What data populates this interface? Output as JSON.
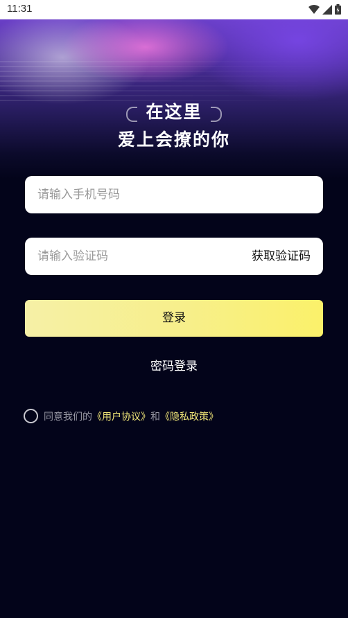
{
  "status_bar": {
    "time": "11:31",
    "icons": [
      "wifi-icon",
      "signal-icon",
      "battery-icon"
    ]
  },
  "hero": {
    "slogan_line1": "在这里",
    "slogan_line2": "爱上会撩的你"
  },
  "phone_field": {
    "placeholder": "请输入手机号码",
    "value": ""
  },
  "code_field": {
    "placeholder": "请输入验证码",
    "value": "",
    "get_code_label": "获取验证码"
  },
  "login_button": {
    "label": "登录"
  },
  "password_login": {
    "label": "密码登录"
  },
  "agreement": {
    "checked": false,
    "prefix": "同意我们的",
    "user_agreement": "《用户协议》",
    "conjunction": "和",
    "privacy_policy": "《隐私政策》"
  },
  "colors": {
    "background": "#03041a",
    "accent_yellow": "#f7ef8a",
    "link_yellow": "#f3e879",
    "hero_purple": "#6a3fc7"
  }
}
